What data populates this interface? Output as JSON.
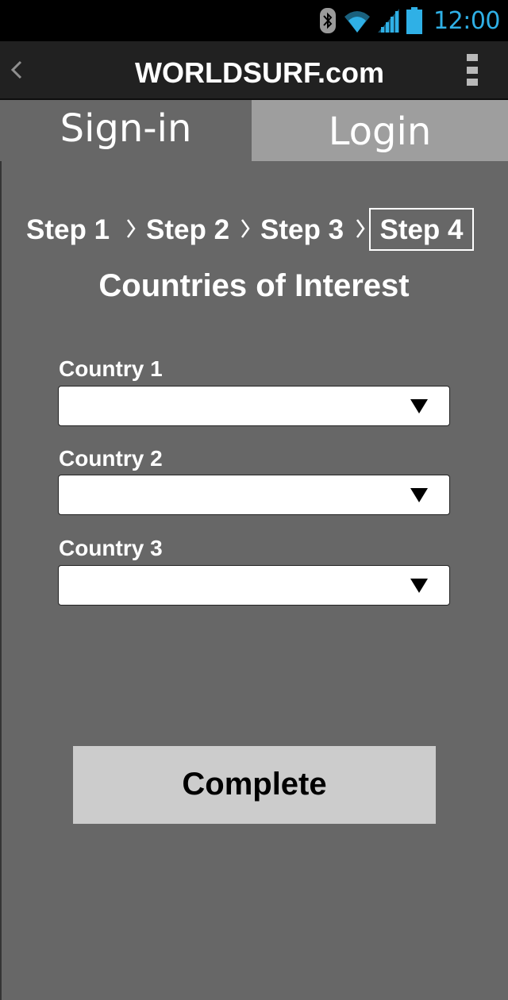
{
  "status_bar": {
    "time": "12:00",
    "icons": [
      "bluetooth-icon",
      "wifi-icon",
      "signal-icon",
      "battery-icon"
    ],
    "accent_color": "#2fb0e6"
  },
  "action_bar": {
    "title": "WORLDSURF.com",
    "back_icon": "chevron-left-icon",
    "menu_icon": "overflow-menu-icon"
  },
  "tabs": [
    {
      "label": "Sign-in",
      "selected": true
    },
    {
      "label": "Login",
      "selected": false
    }
  ],
  "steps": [
    {
      "label": "Step 1"
    },
    {
      "label": "Step 2"
    },
    {
      "label": "Step 3"
    },
    {
      "label": "Step 4",
      "current": true
    }
  ],
  "form": {
    "title": "Countries of Interest",
    "fields": [
      {
        "label": "Country 1",
        "value": ""
      },
      {
        "label": "Country 2",
        "value": ""
      },
      {
        "label": "Country 3",
        "value": ""
      }
    ],
    "submit_label": "Complete"
  },
  "colors": {
    "background": "#676767",
    "tab_inactive": "#9e9e9e",
    "button": "#cccccc"
  }
}
